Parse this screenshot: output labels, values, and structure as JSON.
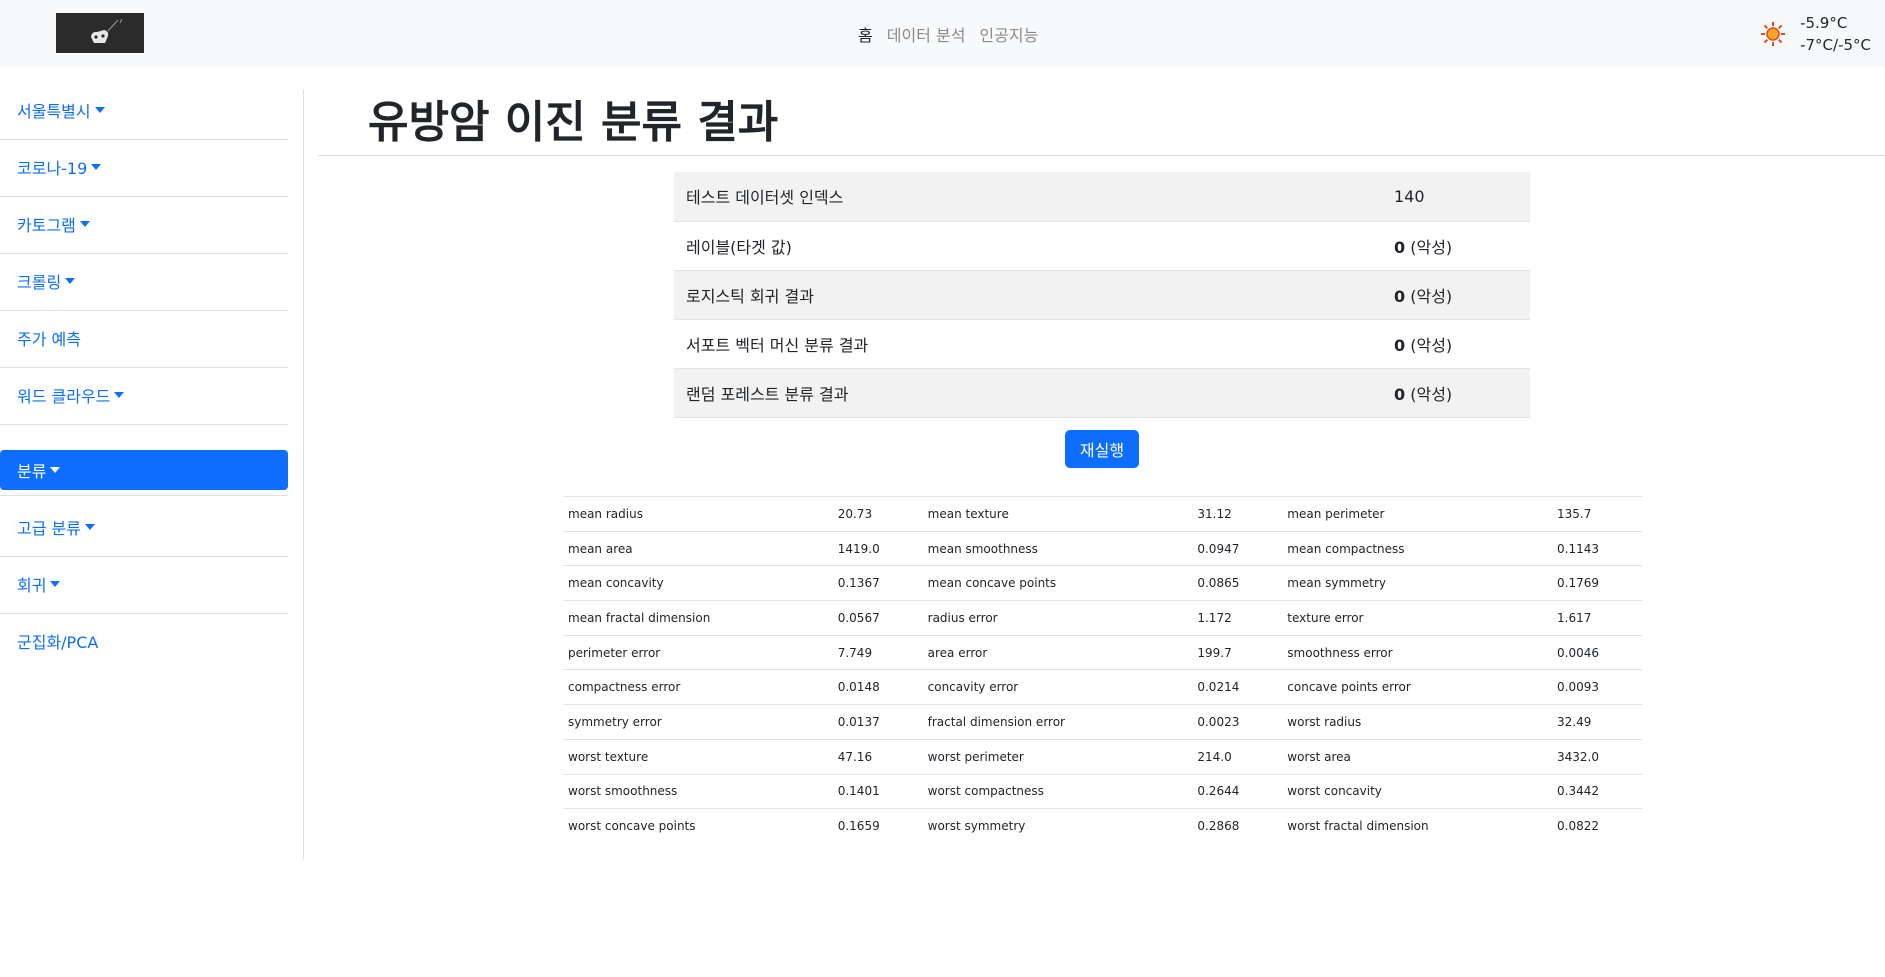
{
  "navbar": {
    "links": [
      "홈",
      "데이터 분석",
      "인공지능"
    ],
    "weather": {
      "icon": "sun-icon",
      "current_temp": "-5.9°C",
      "min_max": "-7°C/-5°C"
    }
  },
  "sidebar": {
    "items": [
      {
        "label": "서울특별시",
        "dropdown": true
      },
      {
        "label": "코로나-19",
        "dropdown": true
      },
      {
        "label": "카토그램",
        "dropdown": true
      },
      {
        "label": "크롤링",
        "dropdown": true
      },
      {
        "label": "주가 예측",
        "dropdown": false
      },
      {
        "label": "워드 클라우드",
        "dropdown": true
      },
      {
        "label": "분류",
        "dropdown": true,
        "active": true
      },
      {
        "label": "고급 분류",
        "dropdown": true
      },
      {
        "label": "회귀",
        "dropdown": true
      },
      {
        "label": "군집화/PCA",
        "dropdown": false
      }
    ]
  },
  "main": {
    "title": "유방암 이진 분류 결과",
    "results": [
      {
        "label": "테스트 데이터셋 인덱스",
        "value": "140",
        "note": ""
      },
      {
        "label": "레이블(타겟 값)",
        "value": "0",
        "note": " (악성)"
      },
      {
        "label": "로지스틱 회귀 결과",
        "value": "0",
        "note": " (악성)"
      },
      {
        "label": "서포트 벡터 머신 분류 결과",
        "value": "0",
        "note": " (악성)"
      },
      {
        "label": "랜덤 포레스트 분류 결과",
        "value": "0",
        "note": " (악성)"
      }
    ],
    "rerun_label": "재실행",
    "features": [
      [
        [
          "mean radius",
          "20.73"
        ],
        [
          "mean texture",
          "31.12"
        ],
        [
          "mean perimeter",
          "135.7"
        ]
      ],
      [
        [
          "mean area",
          "1419.0"
        ],
        [
          "mean smoothness",
          "0.0947"
        ],
        [
          "mean compactness",
          "0.1143"
        ]
      ],
      [
        [
          "mean concavity",
          "0.1367"
        ],
        [
          "mean concave points",
          "0.0865"
        ],
        [
          "mean symmetry",
          "0.1769"
        ]
      ],
      [
        [
          "mean fractal dimension",
          "0.0567"
        ],
        [
          "radius error",
          "1.172"
        ],
        [
          "texture error",
          "1.617"
        ]
      ],
      [
        [
          "perimeter error",
          "7.749"
        ],
        [
          "area error",
          "199.7"
        ],
        [
          "smoothness error",
          "0.0046"
        ]
      ],
      [
        [
          "compactness error",
          "0.0148"
        ],
        [
          "concavity error",
          "0.0214"
        ],
        [
          "concave points error",
          "0.0093"
        ]
      ],
      [
        [
          "symmetry error",
          "0.0137"
        ],
        [
          "fractal dimension error",
          "0.0023"
        ],
        [
          "worst radius",
          "32.49"
        ]
      ],
      [
        [
          "worst texture",
          "47.16"
        ],
        [
          "worst perimeter",
          "214.0"
        ],
        [
          "worst area",
          "3432.0"
        ]
      ],
      [
        [
          "worst smoothness",
          "0.1401"
        ],
        [
          "worst compactness",
          "0.2644"
        ],
        [
          "worst concavity",
          "0.3442"
        ]
      ],
      [
        [
          "worst concave points",
          "0.1659"
        ],
        [
          "worst symmetry",
          "0.2868"
        ],
        [
          "worst fractal dimension",
          "0.0822"
        ]
      ]
    ]
  },
  "colors": {
    "primary": "#0d6efd",
    "navbar_bg": "#f8f9fa",
    "stripe": "#f2f2f2"
  }
}
